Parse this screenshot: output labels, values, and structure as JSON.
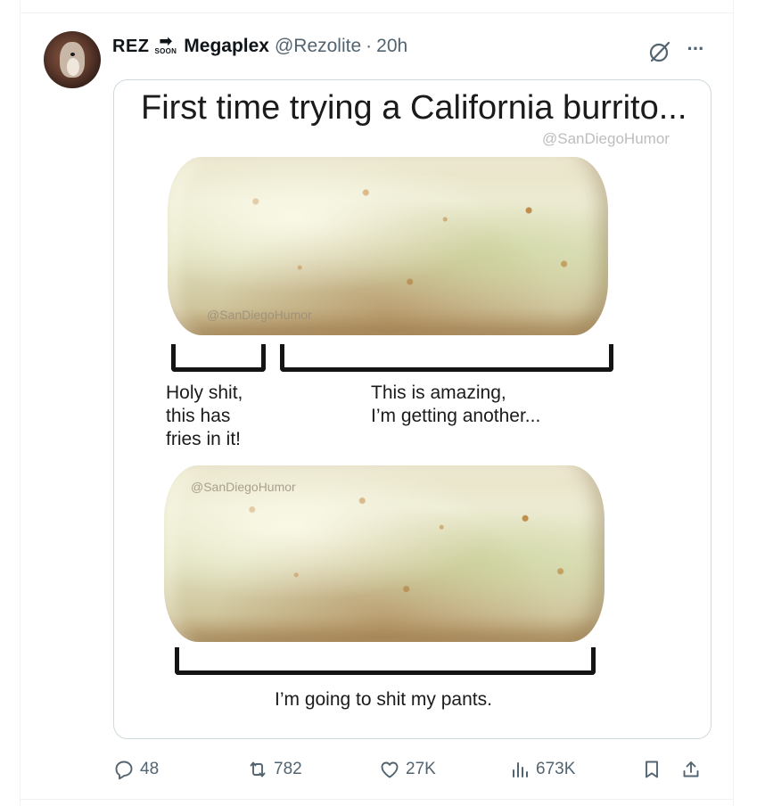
{
  "tweet": {
    "brand": "REZ",
    "brand_badge": "SOON",
    "display_name": "Megaplex",
    "handle": "@Rezolite",
    "separator": "·",
    "time": "20h"
  },
  "meme": {
    "title": "First time trying a California burrito...",
    "watermark": "@SanDiegoHumor",
    "caption_left": [
      "Holy shit,",
      "this has",
      "fries in it!"
    ],
    "caption_right": [
      "This is amazing,",
      "I’m getting another..."
    ],
    "caption_bottom": "I’m going to shit my pants."
  },
  "actions": {
    "replies": "48",
    "reposts": "782",
    "likes": "27K",
    "views": "673K"
  },
  "icons": {
    "reply": "reply-icon",
    "repost": "repost-icon",
    "like": "heart-icon",
    "views": "views-icon",
    "bookmark": "bookmark-icon",
    "share": "share-icon",
    "grok": "grok-icon",
    "more": "more-icon"
  },
  "colors": {
    "text": "#0f1419",
    "secondary": "#536471",
    "border": "#cfd9de"
  }
}
